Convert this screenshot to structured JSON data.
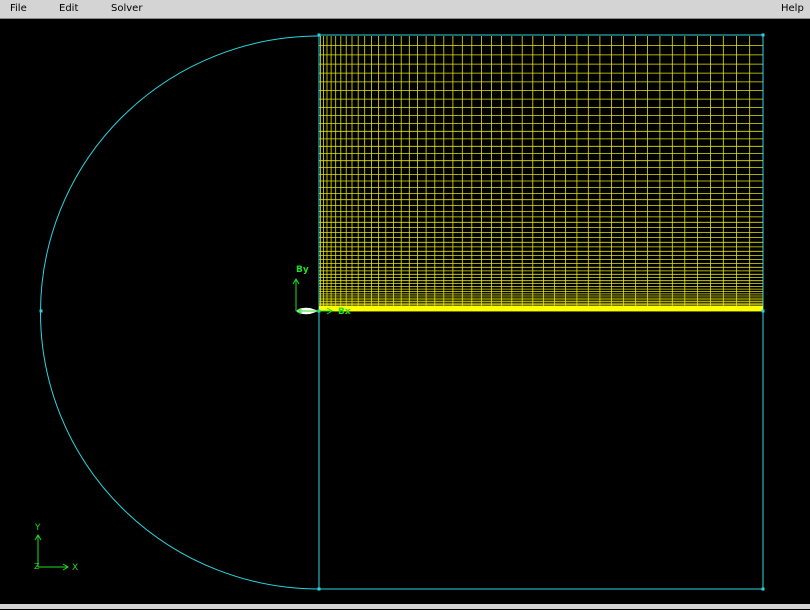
{
  "menubar": {
    "file": "File",
    "edit": "Edit",
    "solver": "Solver",
    "help": "Help"
  },
  "canvas": {
    "background": "#000000",
    "geometry_color": "#29d6e0",
    "mesh_color": "#e6e600",
    "axis_color": "#22dd22"
  },
  "labels": {
    "body_y_axis": "By",
    "body_x_axis": "Bx",
    "global_y_axis": "Y",
    "global_x_axis": "X",
    "global_z_axis": "Z"
  }
}
